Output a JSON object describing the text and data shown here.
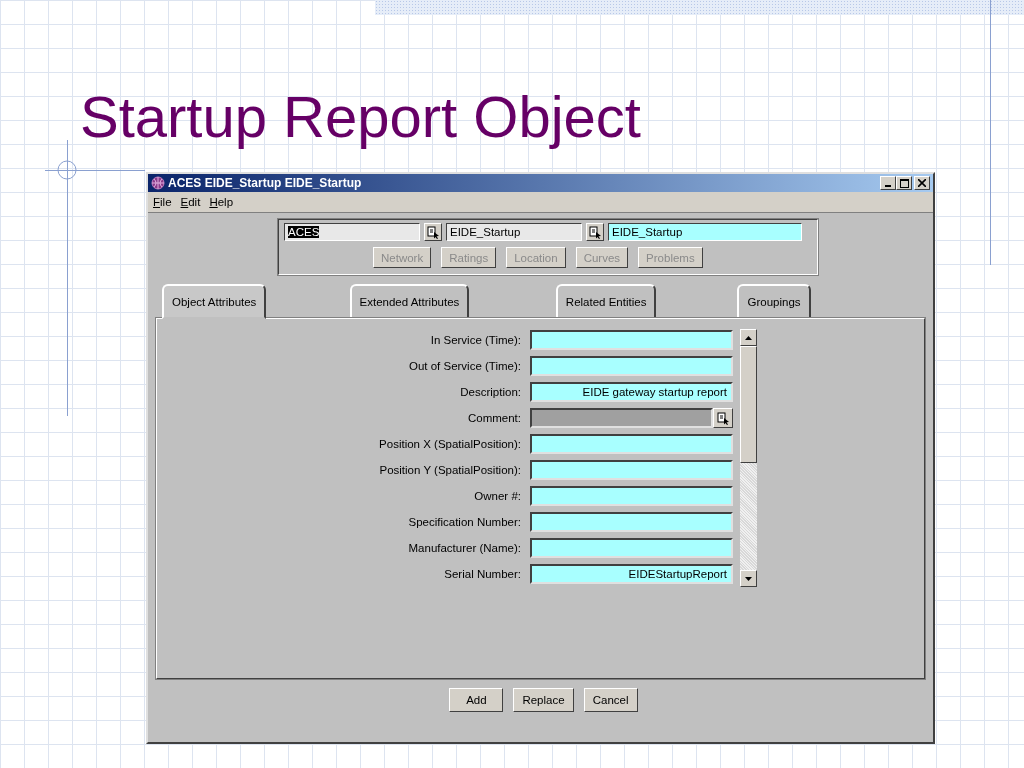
{
  "slide": {
    "title": "Startup Report Object"
  },
  "window": {
    "title": "ACES EIDE_Startup EIDE_Startup",
    "menu": [
      "File",
      "Edit",
      "Help"
    ],
    "header_fields": [
      {
        "value": "ACES",
        "kind": "lookup",
        "selected": true
      },
      {
        "value": "EIDE_Startup",
        "kind": "lookup",
        "selected": false
      },
      {
        "value": "EIDE_Startup",
        "kind": "text",
        "selected": false
      }
    ],
    "nav_buttons": [
      {
        "label": "Network",
        "disabled": true
      },
      {
        "label": "Ratings",
        "disabled": true
      },
      {
        "label": "Location",
        "disabled": true
      },
      {
        "label": "Curves",
        "disabled": true
      },
      {
        "label": "Problems",
        "disabled": true
      }
    ],
    "tabs": [
      {
        "label": "Object Attributes",
        "selected": true
      },
      {
        "label": "Extended Attributes",
        "selected": false
      },
      {
        "label": "Related Entities",
        "selected": false
      },
      {
        "label": "Groupings",
        "selected": false
      }
    ],
    "fields": [
      {
        "label": "In Service (Time):",
        "kind": "text"
      },
      {
        "label": "Out of Service (Time):",
        "kind": "text"
      },
      {
        "label": "Description:",
        "kind": "text",
        "value": "EIDE gateway startup report"
      },
      {
        "label": "Comment:",
        "kind": "lookup"
      },
      {
        "label": "Position X (SpatialPosition):",
        "kind": "text"
      },
      {
        "label": "Position Y (SpatialPosition):",
        "kind": "text"
      },
      {
        "label": "Owner #:",
        "kind": "text"
      },
      {
        "label": "Specification Number:",
        "kind": "text"
      },
      {
        "label": "Manufacturer (Name):",
        "kind": "text"
      },
      {
        "label": "Serial Number:",
        "kind": "text",
        "value": "EIDEStartupReport"
      }
    ],
    "buttons": [
      "Add",
      "Replace",
      "Cancel"
    ]
  }
}
